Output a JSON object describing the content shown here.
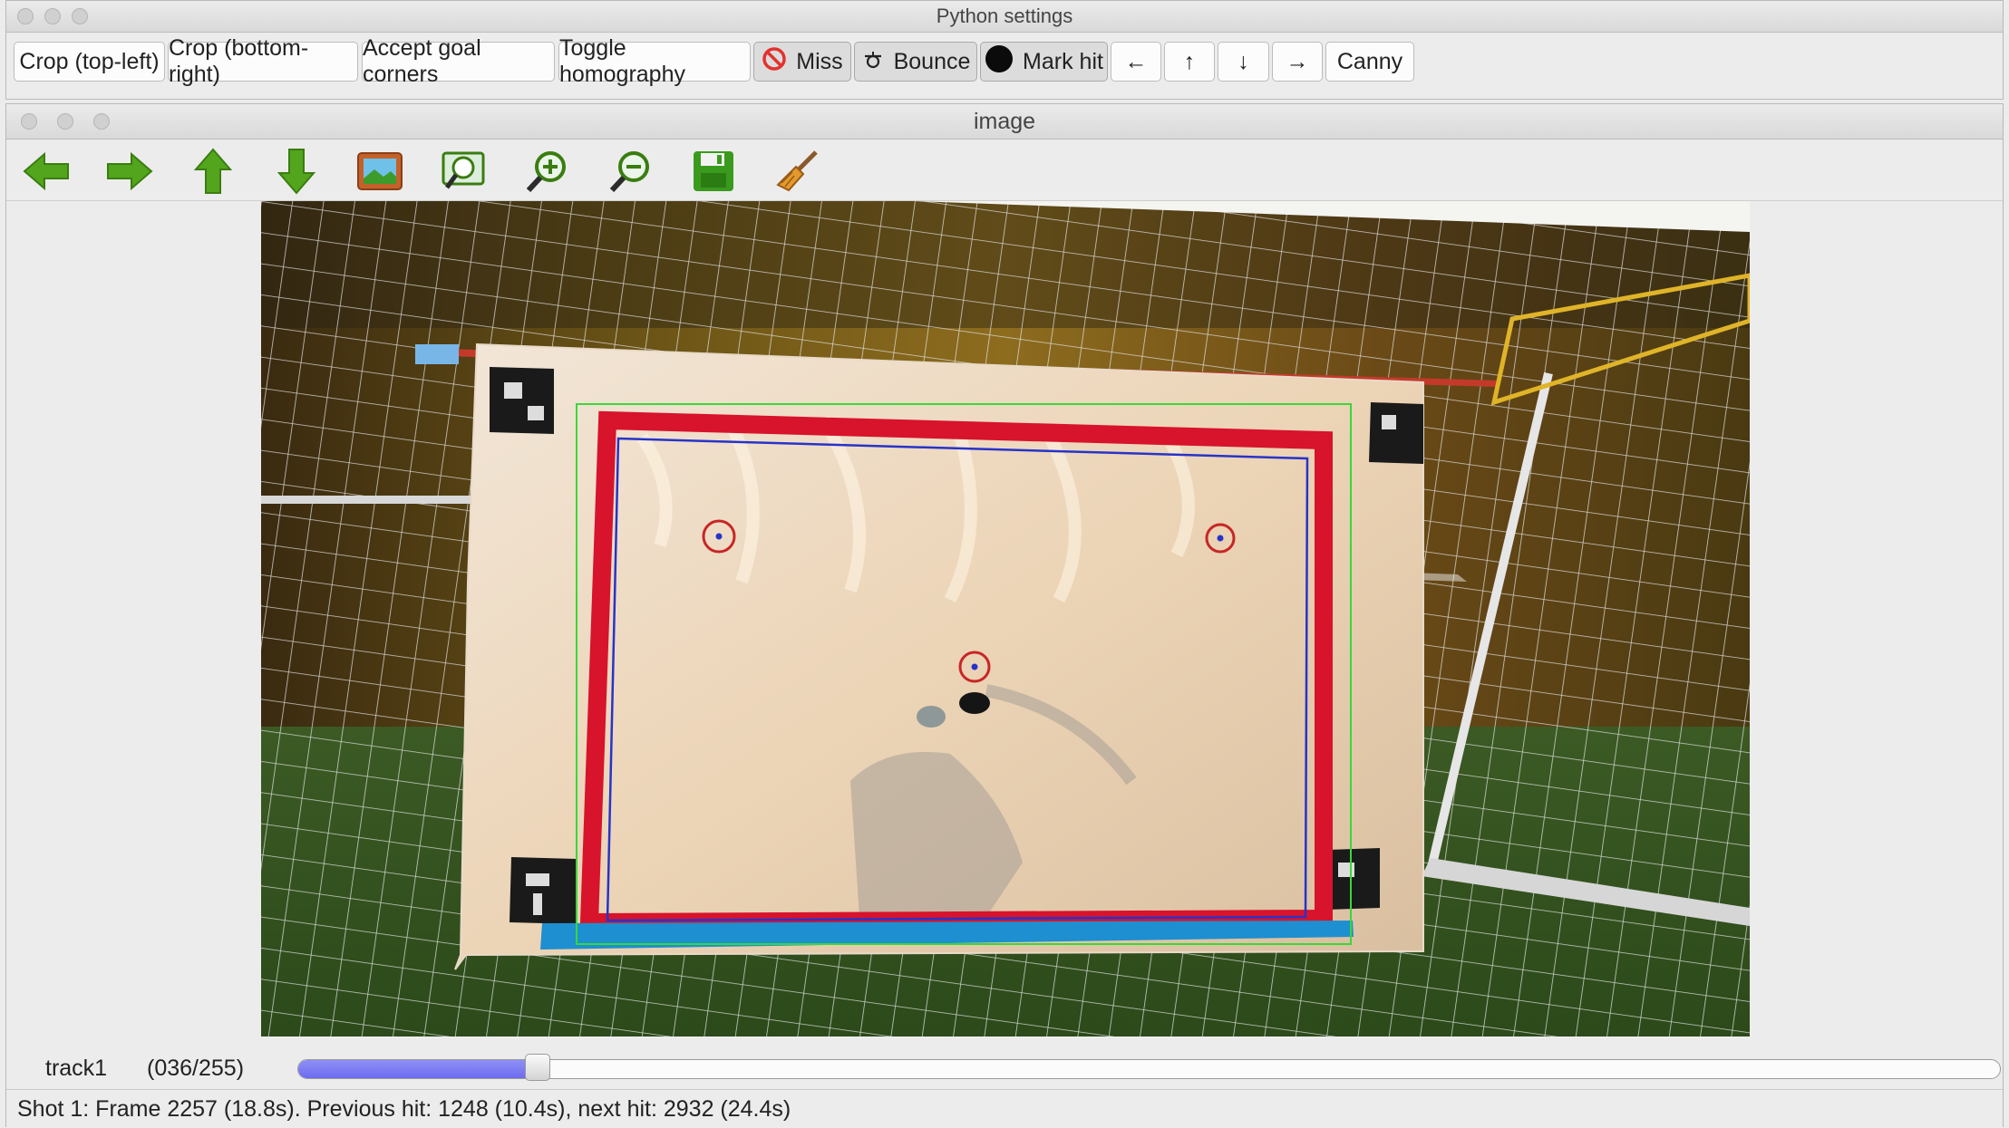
{
  "settings_window": {
    "title": "Python settings",
    "buttons": [
      {
        "label": "Crop (top-left)",
        "icon": ""
      },
      {
        "label": "Crop (bottom-right)",
        "icon": ""
      },
      {
        "label": "Accept goal corners",
        "icon": ""
      },
      {
        "label": "Toggle homography",
        "icon": ""
      },
      {
        "label": "Miss",
        "icon": "no-entry-icon"
      },
      {
        "label": "Bounce",
        "icon": "bounce-icon"
      },
      {
        "label": "Mark hit",
        "icon": "black-circle-icon"
      },
      {
        "label": "←",
        "icon": "arrow-left-icon"
      },
      {
        "label": "↑",
        "icon": "arrow-up-icon"
      },
      {
        "label": "↓",
        "icon": "arrow-down-icon"
      },
      {
        "label": "→",
        "icon": "arrow-right-icon"
      },
      {
        "label": "Canny",
        "icon": ""
      }
    ]
  },
  "image_window": {
    "title": "image",
    "tools": [
      "back-arrow-icon",
      "forward-arrow-icon",
      "up-arrow-icon",
      "down-arrow-icon",
      "image-icon",
      "zoom-fit-icon",
      "zoom-in-icon",
      "zoom-out-icon",
      "save-icon",
      "broom-icon"
    ],
    "trackbar": {
      "name": "track1",
      "value_label": "(036/255)",
      "position": 0.141
    },
    "status": "Shot 1: Frame 2257 (18.8s). Previous hit: 1248 (10.4s), next hit: 2932 (24.4s)"
  },
  "colors": {
    "accent_fill": "#7b7bf2",
    "goal_frame": "#d8132c",
    "overlay_green": "#39d839",
    "overlay_blue": "#2833c8"
  }
}
